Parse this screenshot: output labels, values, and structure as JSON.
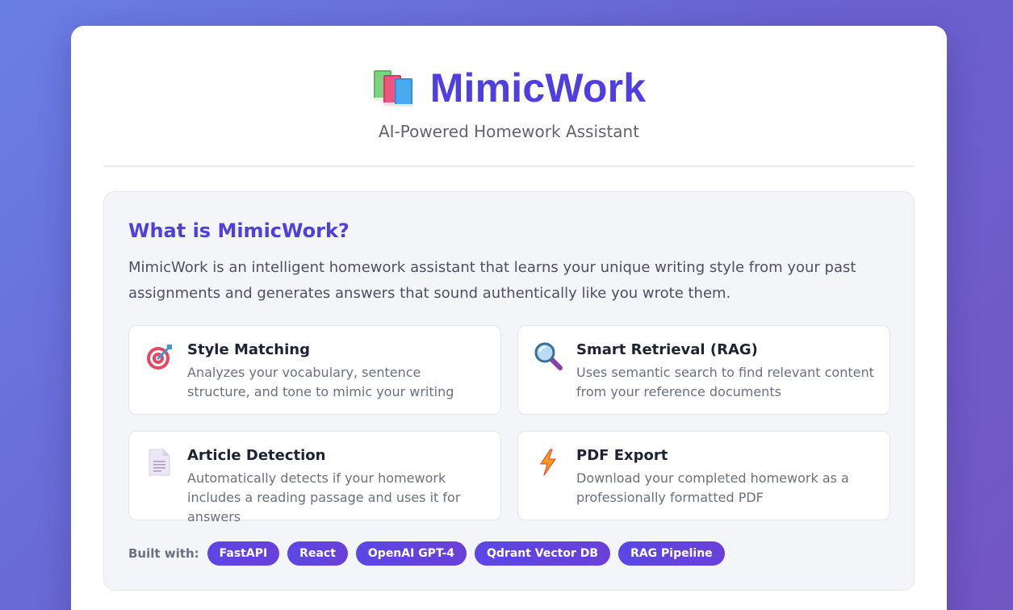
{
  "header": {
    "title": "MimicWork",
    "subtitle": "AI-Powered Homework Assistant",
    "logo_icon": "books-icon"
  },
  "info": {
    "title": "What is MimicWork?",
    "description": "MimicWork is an intelligent homework assistant that learns your unique writing style from your past assignments and generates answers that sound authentically like you wrote them."
  },
  "features": [
    {
      "icon": "target-icon",
      "title": "Style Matching",
      "description": "Analyzes your vocabulary, sentence structure, and tone to mimic your writing"
    },
    {
      "icon": "magnifier-icon",
      "title": "Smart Retrieval (RAG)",
      "description": "Uses semantic search to find relevant content from your reference documents"
    },
    {
      "icon": "document-icon",
      "title": "Article Detection",
      "description": "Automatically detects if your homework includes a reading passage and uses it for answers"
    },
    {
      "icon": "lightning-icon",
      "title": "PDF Export",
      "description": "Download your completed homework as a professionally formatted PDF"
    }
  ],
  "built_with": {
    "label": "Built with:",
    "tags": [
      "FastAPI",
      "React",
      "OpenAI GPT-4",
      "Qdrant Vector DB",
      "RAG Pipeline"
    ]
  },
  "colors": {
    "accent": "#4f3fe0",
    "tag": "#5a47e6",
    "background_start": "#6a7fe6",
    "background_end": "#7256c2"
  }
}
